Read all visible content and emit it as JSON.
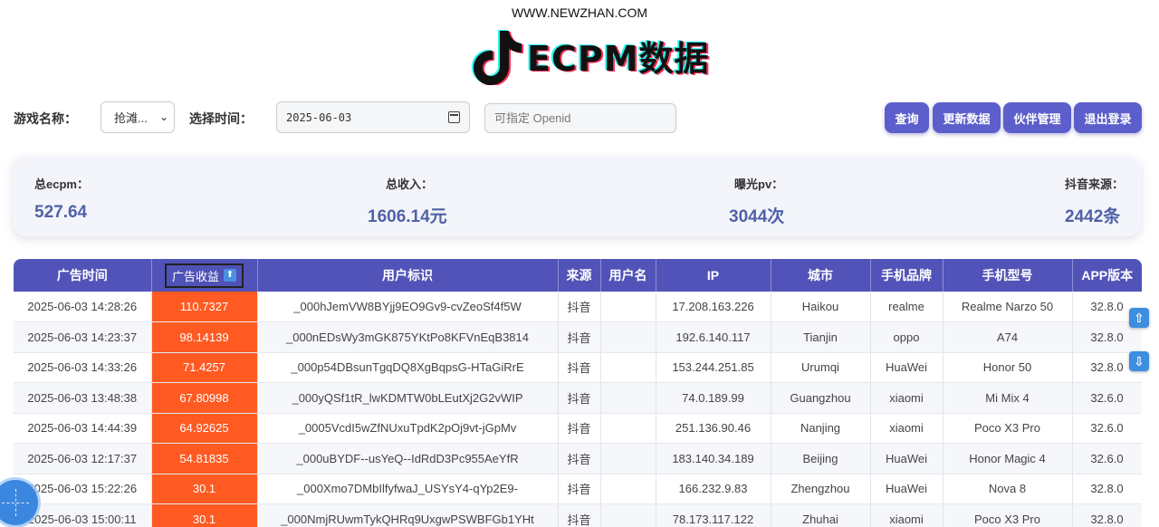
{
  "site": {
    "url": "WWW.NEWZHAN.COM"
  },
  "logo": {
    "text": "ECPM数据"
  },
  "filters": {
    "game_label": "游戏名称：",
    "game_value": "抢滩...",
    "time_label": "选择时间：",
    "date_value": "2025-06-03",
    "openid_placeholder": "可指定 Openid"
  },
  "buttons": {
    "query": "查询",
    "update": "更新数据",
    "partner": "伙伴管理",
    "logout": "退出登录"
  },
  "stats": {
    "ecpm": {
      "label": "总ecpm：",
      "value": "527.64"
    },
    "revenue": {
      "label": "总收入：",
      "value": "1606.14元"
    },
    "pv": {
      "label": "曝光pv：",
      "value": "3044次"
    },
    "source": {
      "label": "抖音来源：",
      "value": "2442条"
    }
  },
  "table": {
    "headers": [
      "广告时间",
      "广告收益",
      "用户标识",
      "来源",
      "用户名",
      "IP",
      "城市",
      "手机品牌",
      "手机型号",
      "APP版本"
    ],
    "rows": [
      [
        "2025-06-03 14:28:26",
        "110.7327",
        "_000hJemVW8BYjj9EO9Gv9-cvZeoSf4f5W",
        "抖音",
        "",
        "17.208.163.226",
        "Haikou",
        "realme",
        "Realme Narzo 50",
        "32.8.0"
      ],
      [
        "2025-06-03 14:23:37",
        "98.14139",
        "_000nEDsWy3mGK875YKtPo8KFVnEqB3814",
        "抖音",
        "",
        "192.6.140.117",
        "Tianjin",
        "oppo",
        "A74",
        "32.8.0"
      ],
      [
        "2025-06-03 14:33:26",
        "71.4257",
        "_000p54DBsunTgqDQ8XgBqpsG-HTaGiRrE",
        "抖音",
        "",
        "153.244.251.85",
        "Urumqi",
        "HuaWei",
        "Honor 50",
        "32.8.0"
      ],
      [
        "2025-06-03 13:48:38",
        "67.80998",
        "_000yQSf1tR_lwKDMTW0bLEutXj2G2vWIP",
        "抖音",
        "",
        "74.0.189.99",
        "Guangzhou",
        "xiaomi",
        "Mi Mix 4",
        "32.6.0"
      ],
      [
        "2025-06-03 14:44:39",
        "64.92625",
        "_0005VcdI5wZfNUxuTpdK2pOj9vt-jGpMv",
        "抖音",
        "",
        "251.136.90.46",
        "Nanjing",
        "xiaomi",
        "Poco X3 Pro",
        "32.6.0"
      ],
      [
        "2025-06-03 12:17:37",
        "54.81835",
        "_000uBYDF--usYeQ--IdRdD3Pc955AeYfR",
        "抖音",
        "",
        "183.140.34.189",
        "Beijing",
        "HuaWei",
        "Honor Magic 4",
        "32.6.0"
      ],
      [
        "2025-06-03 15:22:26",
        "30.1",
        "_000Xmo7DMbIlfyfwaJ_USYsY4-qYp2E9-",
        "抖音",
        "",
        "166.232.9.83",
        "Zhengzhou",
        "HuaWei",
        "Nova 8",
        "32.8.0"
      ],
      [
        "2025-06-03 15:00:11",
        "30.1",
        "_000NmjRUwmTykQHRq9UxgwPSWBFGb1YHt",
        "抖音",
        "",
        "78.173.117.122",
        "Zhuhai",
        "xiaomi",
        "Poco X3 Pro",
        "32.8.0"
      ]
    ]
  },
  "colors": {
    "primary": "#5c5fcb",
    "header": "#5253b8",
    "revenue_cell": "#fe5a22",
    "stat_value": "#5061a8"
  },
  "icons": {
    "sort": "arrow-up-icon",
    "scroll_up": "scroll-up-icon",
    "scroll_down": "scroll-down-icon"
  }
}
